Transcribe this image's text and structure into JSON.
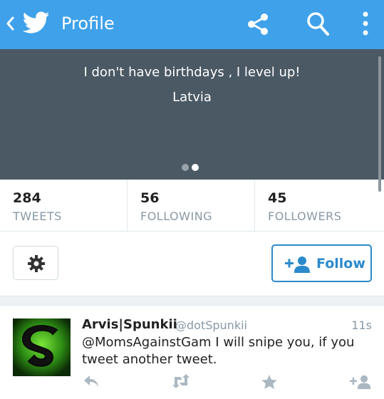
{
  "topbar": {
    "title": "Profile",
    "icons": [
      "back-chevron-icon",
      "twitter-bird-icon",
      "share-icon",
      "search-icon",
      "more-vertical-icon"
    ],
    "background": "#3fa1ea"
  },
  "banner": {
    "bio": "I don't have birthdays , I level up!",
    "location": "Latvia",
    "page_dots": {
      "count": 2,
      "active": 2
    },
    "background": "#4a5964"
  },
  "stats": [
    {
      "value": "284",
      "label": "TWEETS"
    },
    {
      "value": "56",
      "label": "FOLLOWING"
    },
    {
      "value": "45",
      "label": "FOLLOWERS"
    }
  ],
  "actions": {
    "settings_icon": "gear-icon",
    "follow_label": "Follow",
    "follow_icon": "add-user-icon",
    "accent": "#2b8acb"
  },
  "tweet": {
    "name": "Arvis|Spunkii",
    "handle": "@dotSpunkii",
    "time": "11s",
    "line1": "@MomsAgainstGam I will snipe you, if you",
    "line2": "tweet another tweet.",
    "actions": [
      "reply-icon",
      "retweet-icon",
      "favorite-star-icon",
      "follow-user-icon"
    ]
  }
}
